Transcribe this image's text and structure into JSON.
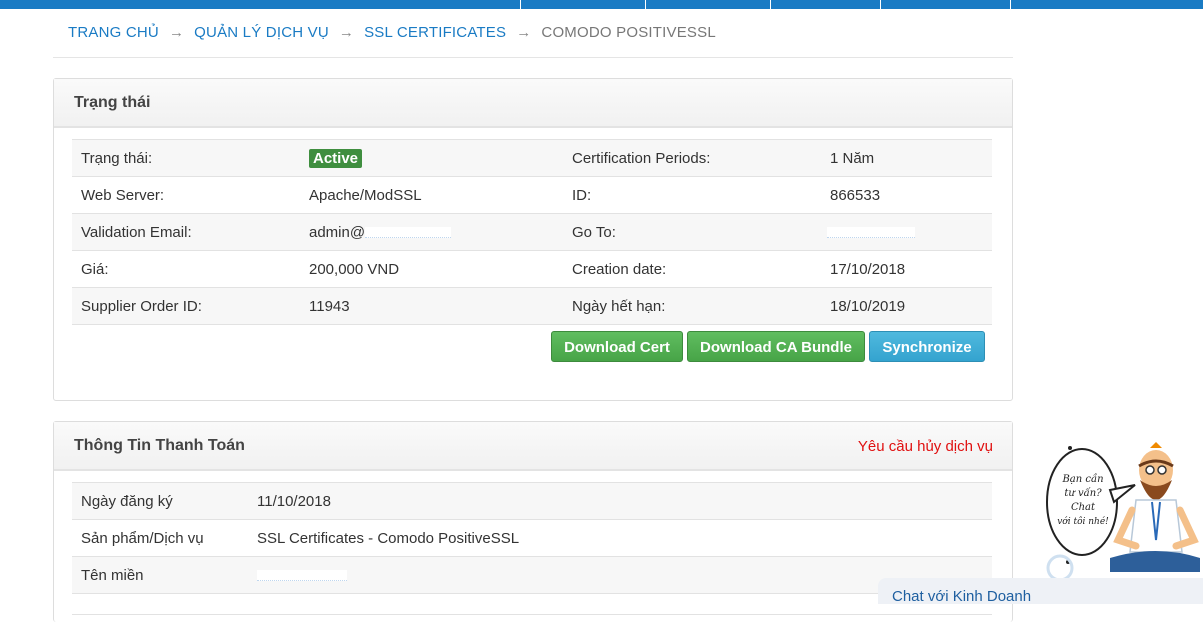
{
  "breadcrumb": {
    "home": "TRANG CHỦ",
    "services": "QUẢN LÝ DỊCH VỤ",
    "ssl": "SSL CERTIFICATES",
    "current": "COMODO POSITIVESSL",
    "arrow": "→"
  },
  "status_panel": {
    "title": "Trạng thái",
    "rows": [
      {
        "l1": "Trạng thái:",
        "v1": "Active",
        "l2": "Certification Periods:",
        "v2": "1 Năm"
      },
      {
        "l1": "Web Server:",
        "v1": "Apache/ModSSL",
        "l2": "ID:",
        "v2": "866533"
      },
      {
        "l1": "Validation Email:",
        "v1": "admin@",
        "l2": "Go To:",
        "v2": ""
      },
      {
        "l1": "Giá:",
        "v1": "200,000 VND",
        "l2": "Creation date:",
        "v2": "17/10/2018"
      },
      {
        "l1": "Supplier Order ID:",
        "v1": "11943",
        "l2": "Ngày hết hạn:",
        "v2": "18/10/2019"
      }
    ],
    "buttons": {
      "download_cert": "Download Cert",
      "download_ca": "Download CA Bundle",
      "synchronize": "Synchronize"
    }
  },
  "payment_panel": {
    "title": "Thông Tin Thanh Toán",
    "cancel_link": "Yêu cầu hủy dịch vụ",
    "rows": [
      {
        "label": "Ngày đăng ký",
        "value": "11/10/2018"
      },
      {
        "label": "Sản phẩm/Dịch vụ",
        "value": "SSL Certificates - Comodo PositiveSSL"
      },
      {
        "label": "Tên miền",
        "value": ""
      }
    ]
  },
  "chat": {
    "bubble_line1": "Bạn cần",
    "bubble_line2": "tư vấn?",
    "bubble_line3": "Chat",
    "bubble_line4": "với tôi nhé!",
    "bar_label": "Chat với Kinh Doanh"
  },
  "colors": {
    "accent": "#1a7bc4",
    "success": "#47a447",
    "info": "#34a3cf",
    "danger": "#e01010"
  }
}
